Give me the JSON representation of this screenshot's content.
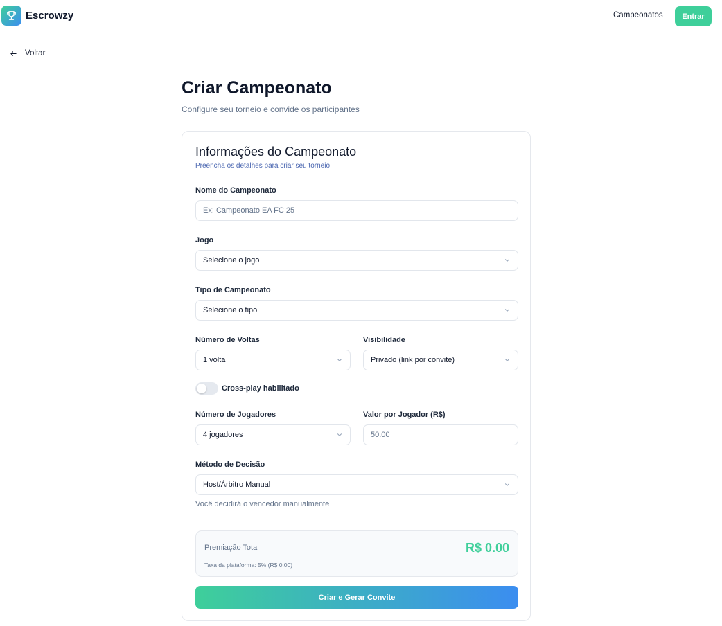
{
  "header": {
    "brand": "Escrowzy",
    "nav_link": "Campeonatos",
    "enter_button": "Entrar"
  },
  "back_label": "Voltar",
  "page": {
    "title": "Criar Campeonato",
    "subtitle": "Configure seu torneio e convide os participantes"
  },
  "card": {
    "title": "Informações do Campeonato",
    "subtitle": "Preencha os detalhes para criar seu torneio"
  },
  "form": {
    "name": {
      "label": "Nome do Campeonato",
      "placeholder": "Ex: Campeonato EA FC 25",
      "value": ""
    },
    "game": {
      "label": "Jogo",
      "value": "Selecione o jogo"
    },
    "type": {
      "label": "Tipo de Campeonato",
      "value": "Selecione o tipo"
    },
    "rounds": {
      "label": "Número de Voltas",
      "value": "1 volta"
    },
    "visibility": {
      "label": "Visibilidade",
      "value": "Privado (link por convite)"
    },
    "crossplay": {
      "label": "Cross-play habilitado",
      "enabled": false
    },
    "players": {
      "label": "Número de Jogadores",
      "value": "4 jogadores"
    },
    "price": {
      "label": "Valor por Jogador (R$)",
      "placeholder": "50.00",
      "value": ""
    },
    "decision": {
      "label": "Método de Decisão",
      "value": "Host/Árbitro Manual",
      "hint": "Você decidirá o vencedor manualmente"
    }
  },
  "prize": {
    "label": "Premiação Total",
    "value": "R$ 0.00",
    "fee": "Taxa da plataforma: 5% (R$ 0.00)"
  },
  "submit_button": "Criar e Gerar Convite",
  "icons": {
    "logo": "trophy-icon",
    "back": "arrow-left-icon",
    "select": "chevron-down-icon"
  },
  "colors": {
    "accent_green": "#3ecf9a",
    "accent_blue": "#3b8df0",
    "text_dark": "#0f172a",
    "text_muted": "#64748b"
  }
}
